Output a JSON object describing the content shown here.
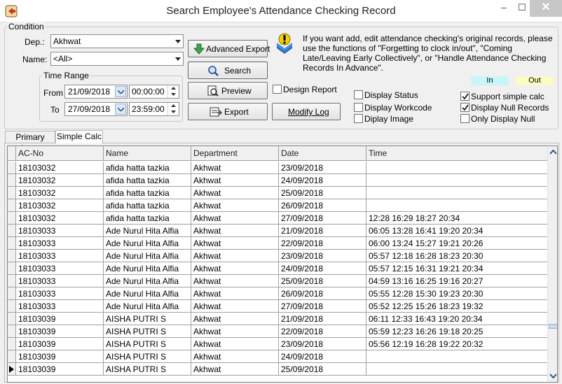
{
  "window": {
    "title": "Search Employee's Attendance Checking Record",
    "minimize": "–",
    "maximize": "☐",
    "close": "✕"
  },
  "condition": {
    "label": "Condition",
    "dep_label": "Dep.:",
    "dep_value": "Akhwat",
    "name_label": "Name:",
    "name_value": "<All>",
    "time_range": {
      "label": "Time Range",
      "from_label": "From",
      "from_date": "21/09/2018",
      "from_time": "00:00:00",
      "to_label": "To",
      "to_date": "27/09/2018",
      "to_time": "23:59:00"
    },
    "buttons": {
      "advanced_export": "Advanced Export",
      "search": "Search",
      "preview": "Preview",
      "export": "Export",
      "modify_log": "Modify Log"
    },
    "design_report": "Design Report",
    "info": "If you want add, edit attendance checking's original records, please use the functions of \"Forgetting to clock in/out\", \"Coming Late/Leaving Early Collectively\", or \"Handle Attendance Checking Records In Advance\".",
    "legend_in": "In",
    "legend_out": "Out",
    "checks": {
      "display_status": {
        "label": "Display Status",
        "checked": false
      },
      "display_workcode": {
        "label": "Display Workcode",
        "checked": false
      },
      "display_image": {
        "label": "Diplay Image",
        "checked": false
      },
      "support_simple_calc": {
        "label": "Support simple calc",
        "checked": true
      },
      "display_null_records": {
        "label": "Display Null Records",
        "checked": true
      },
      "only_display_null": {
        "label": "Only Display Null",
        "checked": false
      }
    }
  },
  "tabs": [
    "Primary Logs",
    "Simple Calc"
  ],
  "grid": {
    "columns": [
      "AC-No",
      "Name",
      "Department",
      "Date",
      "Time"
    ],
    "rows": [
      [
        "18103032",
        "afida hatta tazkia",
        "Akhwat",
        "23/09/2018",
        ""
      ],
      [
        "18103032",
        "afida hatta tazkia",
        "Akhwat",
        "24/09/2018",
        ""
      ],
      [
        "18103032",
        "afida hatta tazkia",
        "Akhwat",
        "25/09/2018",
        ""
      ],
      [
        "18103032",
        "afida hatta tazkia",
        "Akhwat",
        "26/09/2018",
        ""
      ],
      [
        "18103032",
        "afida hatta tazkia",
        "Akhwat",
        "27/09/2018",
        "12:28 16:29 18:27 20:34"
      ],
      [
        "18103033",
        "Ade Nurul Hita Alfia",
        "Akhwat",
        "21/09/2018",
        "06:05 13:28 16:41 19:20 20:34"
      ],
      [
        "18103033",
        "Ade Nurul Hita Alfia",
        "Akhwat",
        "22/09/2018",
        "06:00 13:24 15:27 19:21 20:26"
      ],
      [
        "18103033",
        "Ade Nurul Hita Alfia",
        "Akhwat",
        "23/09/2018",
        "05:57 12:18 16:28 18:23 20:30"
      ],
      [
        "18103033",
        "Ade Nurul Hita Alfia",
        "Akhwat",
        "24/09/2018",
        "05:57 12:15 16:31 19:21 20:34"
      ],
      [
        "18103033",
        "Ade Nurul Hita Alfia",
        "Akhwat",
        "25/09/2018",
        "04:59 13:16 16:25 19:16 20:27"
      ],
      [
        "18103033",
        "Ade Nurul Hita Alfia",
        "Akhwat",
        "26/09/2018",
        "05:55 12:28 15:30 19:23 20:30"
      ],
      [
        "18103033",
        "Ade Nurul Hita Alfia",
        "Akhwat",
        "27/09/2018",
        "05:52 12:25 15:26 18:23 19:32"
      ],
      [
        "18103039",
        "AISHA PUTRI S",
        "Akhwat",
        "21/09/2018",
        "06:11 12:33 16:43 19:20 20:34"
      ],
      [
        "18103039",
        "AISHA PUTRI S",
        "Akhwat",
        "22/09/2018",
        "05:59 12:23 16:26 19:18 20:25"
      ],
      [
        "18103039",
        "AISHA PUTRI S",
        "Akhwat",
        "23/09/2018",
        "05:56 12:19 16:28 19:22 20:32"
      ],
      [
        "18103039",
        "AISHA PUTRI S",
        "Akhwat",
        "24/09/2018",
        ""
      ],
      [
        "18103039",
        "AISHA PUTRI S",
        "Akhwat",
        "25/09/2018",
        ""
      ]
    ],
    "current_row": 16
  }
}
